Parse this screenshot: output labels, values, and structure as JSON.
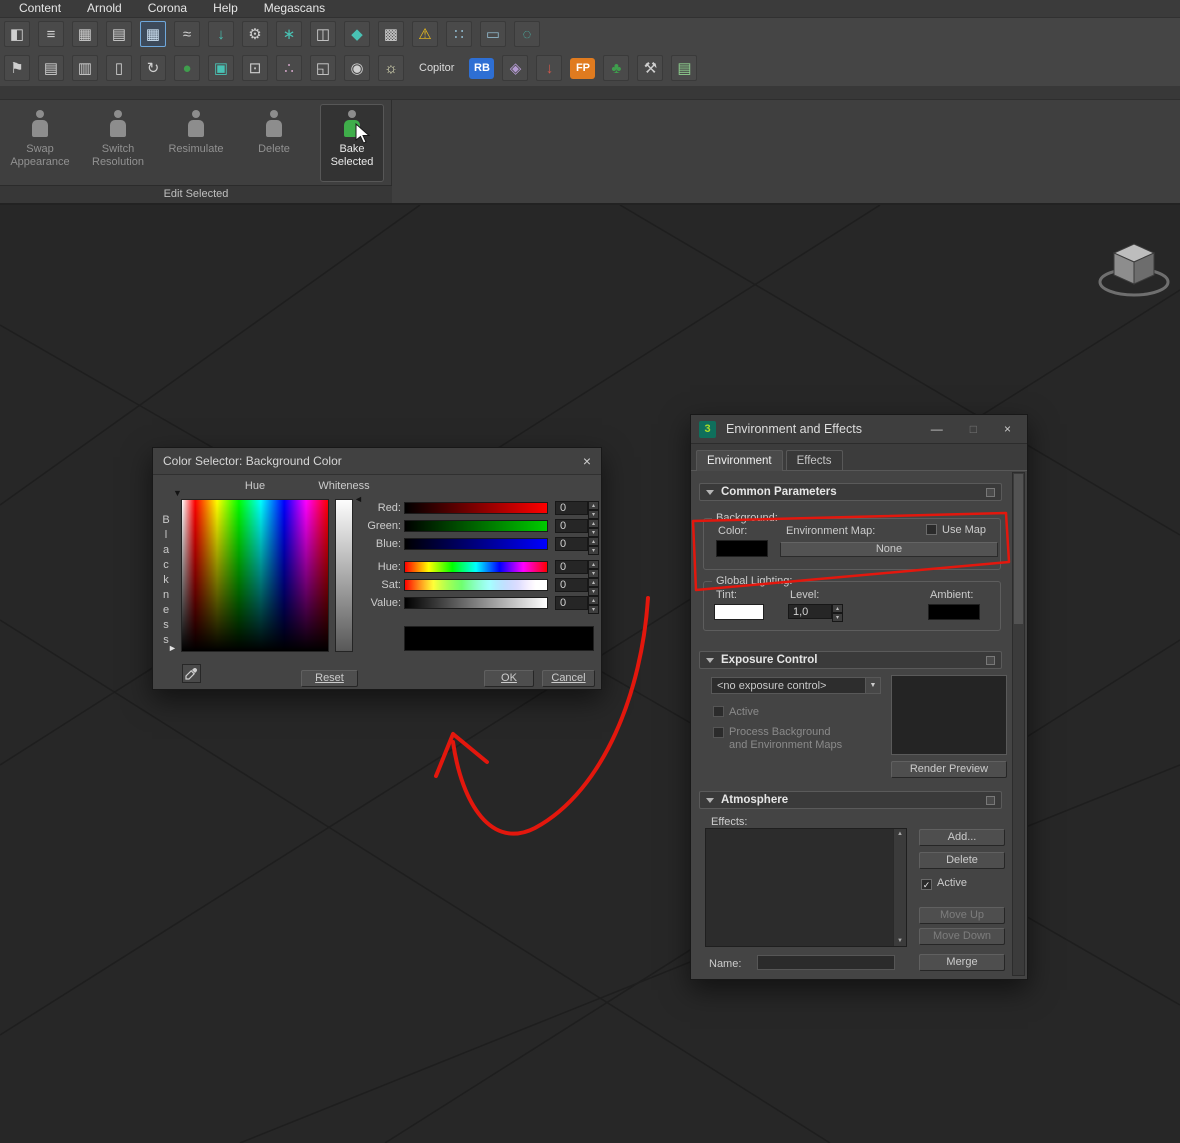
{
  "menu_bar": {
    "items": [
      "Content",
      "Arnold",
      "Corona",
      "Help",
      "Megascans"
    ]
  },
  "toolbar": {
    "row1": [
      {
        "name": "viewport-config-icon",
        "glyph": "◧"
      },
      {
        "name": "align-list-icon",
        "glyph": "≡"
      },
      {
        "name": "table-view-icon",
        "glyph": "▦"
      },
      {
        "name": "layer-manager-icon",
        "glyph": "▤"
      },
      {
        "name": "grid-panel-icon",
        "glyph": "▦",
        "sel": true,
        "fg": "#cfe2f3"
      },
      {
        "name": "curve-editor-icon",
        "glyph": "≈"
      },
      {
        "name": "import-download-icon",
        "glyph": "↓",
        "fg": "#49c2b4"
      },
      {
        "name": "gear-arrow-icon",
        "glyph": "⚙"
      },
      {
        "name": "key-tool-icon",
        "glyph": "∗",
        "fg": "#49c2b4"
      },
      {
        "name": "render-table-icon",
        "glyph": "◫"
      },
      {
        "name": "pointer-star-icon",
        "glyph": "◆",
        "fg": "#49c2b4"
      },
      {
        "name": "grid-blocks-icon",
        "glyph": "▩"
      },
      {
        "name": "warning-icon",
        "glyph": "⚠",
        "fg": "#f2c21b"
      },
      {
        "name": "dot-grid-icon",
        "glyph": "∷",
        "fg": "#8fb6c9"
      },
      {
        "name": "ruler-icon",
        "glyph": "▭",
        "fg": "#8fb6c9"
      },
      {
        "name": "dot-circle-icon",
        "glyph": "◌",
        "fg": "#49c2b4"
      }
    ],
    "row2": [
      {
        "name": "flag-icon",
        "glyph": "⚑"
      },
      {
        "name": "book-icon",
        "glyph": "▤"
      },
      {
        "name": "stats-icon",
        "glyph": "▥"
      },
      {
        "name": "device-icon",
        "glyph": "▯"
      },
      {
        "name": "reset-loop-icon",
        "glyph": "↻"
      },
      {
        "name": "globe-icon",
        "glyph": "●",
        "fg": "#3f9e4d"
      },
      {
        "name": "image-icon",
        "glyph": "▣",
        "fg": "#49c2b4"
      },
      {
        "name": "screen-icon",
        "glyph": "⊡"
      },
      {
        "name": "node-graph-icon",
        "glyph": "∴",
        "fg": "#c9a0c0"
      },
      {
        "name": "window-copy-icon",
        "glyph": "◱"
      },
      {
        "name": "camera-view-icon",
        "glyph": "◉"
      },
      {
        "name": "lightbulb-icon",
        "glyph": "☼",
        "fg": "#e8e8c0"
      },
      {
        "name": "copitor-button",
        "type": "text",
        "label": "Copitor"
      },
      {
        "name": "rb-button",
        "type": "badge",
        "label": "RB",
        "bg": "#2e6fd4",
        "fg": "#fff"
      },
      {
        "name": "diamond-tool-icon",
        "glyph": "◈",
        "fg": "#b49ad2"
      },
      {
        "name": "drop-arrow-icon",
        "glyph": "↓",
        "fg": "#d2574a"
      },
      {
        "name": "fp-button",
        "type": "badge",
        "label": "FP",
        "bg": "#e07b1f",
        "fg": "#fff"
      },
      {
        "name": "tree-icon",
        "glyph": "♣",
        "fg": "#3f9e4d"
      },
      {
        "name": "tools-icon",
        "glyph": "⚒"
      },
      {
        "name": "list-green-icon",
        "glyph": "▤",
        "fg": "#8fd08f"
      }
    ]
  },
  "ribbon": {
    "group_label": "Edit Selected",
    "tools": [
      {
        "label": "Swap Appearance"
      },
      {
        "label": "Switch Resolution"
      },
      {
        "label": "Resimulate"
      },
      {
        "label": "Delete"
      },
      {
        "label": "Bake Selected",
        "active": true
      }
    ]
  },
  "color_selector": {
    "title": "Color Selector: Background Color",
    "close": "×",
    "hue_label": "Hue",
    "whiteness_label": "Whiteness",
    "blackness_label": "Blackness",
    "channels": [
      {
        "key": "red",
        "label": "Red:",
        "value": "0"
      },
      {
        "key": "green",
        "label": "Green:",
        "value": "0"
      },
      {
        "key": "blue",
        "label": "Blue:",
        "value": "0"
      },
      {
        "key": "hue",
        "label": "Hue:",
        "value": "0"
      },
      {
        "key": "sat",
        "label": "Sat:",
        "value": "0"
      },
      {
        "key": "value",
        "label": "Value:",
        "value": "0"
      }
    ],
    "reset": "Reset",
    "ok": "OK",
    "cancel": "Cancel"
  },
  "environment": {
    "title": "Environment and Effects",
    "icon_label": "3",
    "minimize": "—",
    "maximize": "□",
    "close": "×",
    "tabs": [
      {
        "label": "Environment"
      },
      {
        "label": "Effects"
      }
    ],
    "common": {
      "header": "Common Parameters",
      "background_label": "Background:",
      "color_label": "Color:",
      "env_map_label": "Environment Map:",
      "use_map_label": "Use Map",
      "map_button": "None",
      "global_label": "Global Lighting:",
      "tint_label": "Tint:",
      "level_label": "Level:",
      "level_value": "1,0",
      "ambient_label": "Ambient:"
    },
    "exposure": {
      "header": "Exposure Control",
      "selector": "<no exposure control>",
      "active_label": "Active",
      "process_line1": "Process Background",
      "process_line2": "and Environment Maps",
      "render_preview": "Render Preview"
    },
    "atmosphere": {
      "header": "Atmosphere",
      "effects_label": "Effects:",
      "add": "Add...",
      "delete": "Delete",
      "active": "Active",
      "check": "✓",
      "move_up": "Move Up",
      "move_down": "Move Down",
      "name_label": "Name:",
      "merge": "Merge"
    }
  },
  "ui": {
    "spin_up": "▴",
    "spin_down": "▾",
    "dropdown_arrow": "▼",
    "scroll_up": "▲",
    "scroll_down": "▼"
  },
  "annotation_color": "#e3170d"
}
